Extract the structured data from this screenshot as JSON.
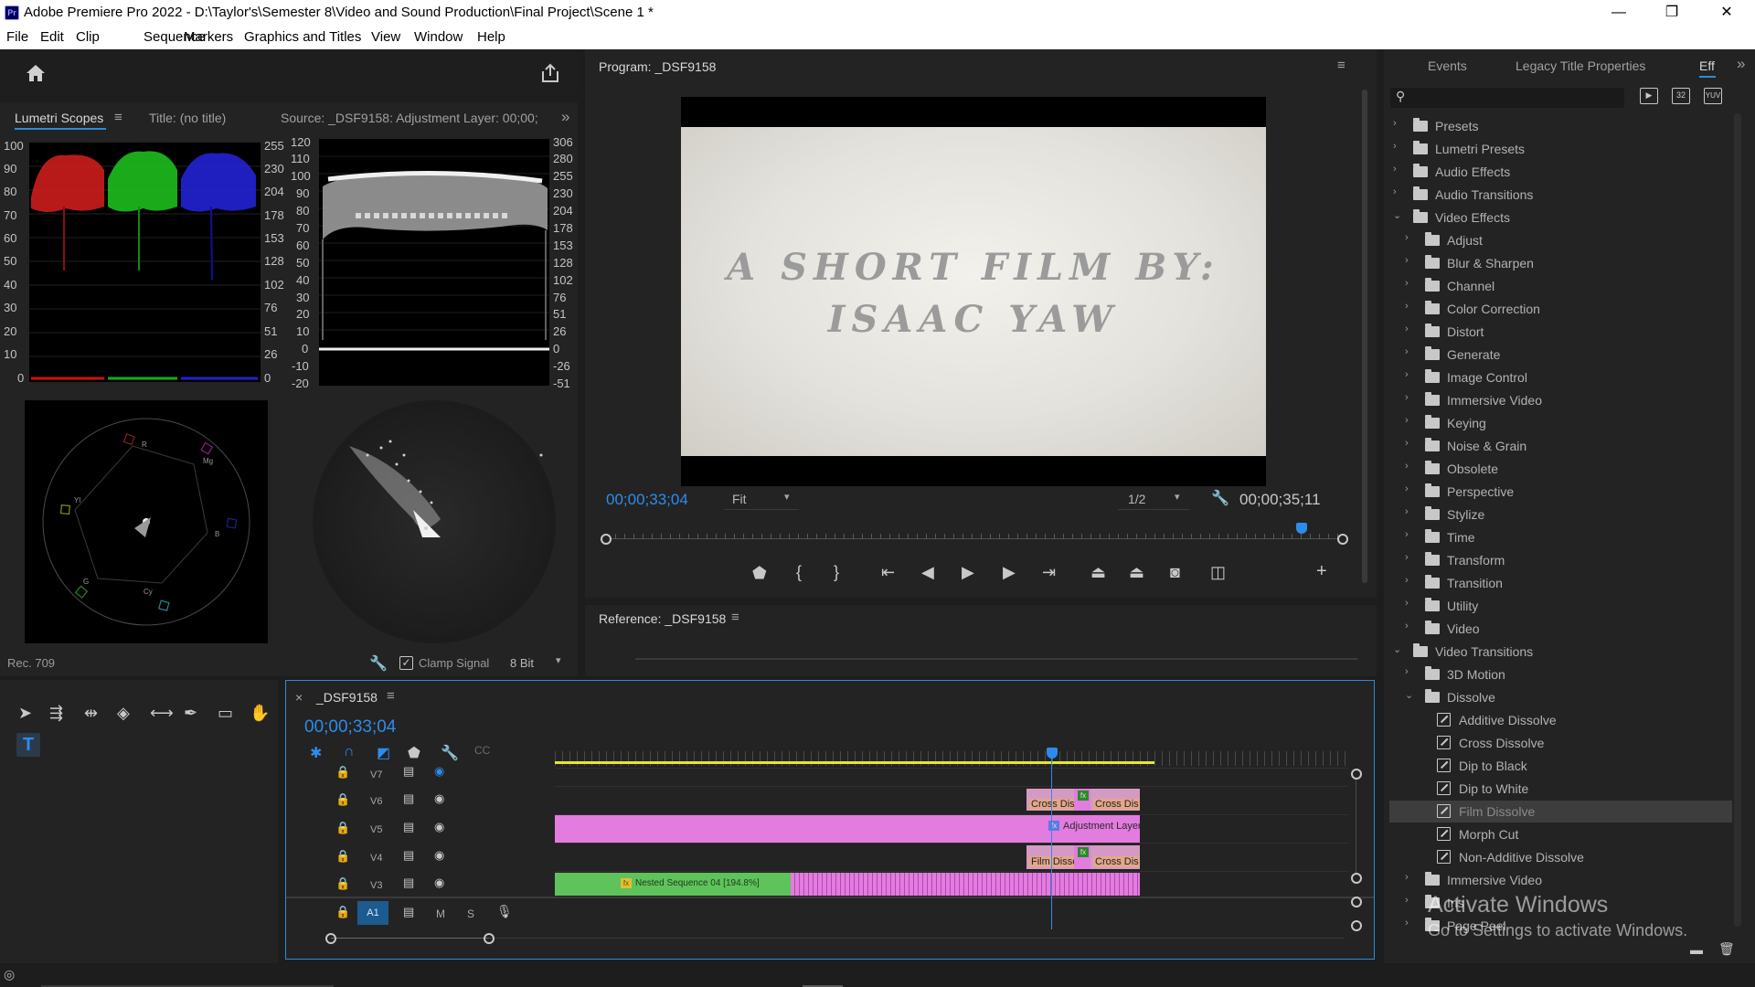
{
  "window": {
    "title": "Adobe Premiere Pro 2022 - D:\\Taylor's\\Semester 8\\Video and Sound Production\\Final Project\\Scene 1 *",
    "app_icon": "Pr",
    "minimize": "—",
    "maximize": "❐",
    "close": "✕"
  },
  "menu": [
    "File",
    "Edit",
    "Clip",
    "Sequence",
    "Markers",
    "Graphics and Titles",
    "View",
    "Window",
    "Help"
  ],
  "source_panel": {
    "tabs": {
      "lumetri": "Lumetri Scopes",
      "title": "Title: (no title)",
      "source": "Source: _DSF9158: Adjustment Layer: 00;00;"
    },
    "parade_scale": [
      "100",
      "90",
      "80",
      "70",
      "60",
      "50",
      "40",
      "30",
      "20",
      "10",
      "0"
    ],
    "parade_right_scale": [
      "255",
      "230",
      "204",
      "178",
      "153",
      "128",
      "102",
      "76",
      "51",
      "26",
      "0"
    ],
    "wave_left_scale": [
      "120",
      "110",
      "100",
      "90",
      "80",
      "70",
      "60",
      "50",
      "40",
      "30",
      "20",
      "10",
      "0",
      "-10",
      "-20"
    ],
    "wave_right_scale": [
      "306",
      "280",
      "255",
      "230",
      "204",
      "178",
      "153",
      "128",
      "102",
      "76",
      "51",
      "26",
      "0",
      "-26",
      "-51"
    ],
    "vectorscope_labels": {
      "r": "R",
      "mg": "Mg",
      "b": "B",
      "cy": "Cy",
      "g": "G",
      "yl": "Yl"
    },
    "footer": {
      "space": "Rec. 709",
      "clamp": "Clamp Signal",
      "bit": "8 Bit"
    }
  },
  "program": {
    "title": "Program: _DSF9158",
    "video_text_line1": "A SHORT FILM BY:",
    "video_text_line2": "ISAAC YAW",
    "timecode": "00;00;33;04",
    "fit": "Fit",
    "resolution": "1/2",
    "duration": "00;00;35;11",
    "playhead_fraction": 0.94
  },
  "reference": {
    "title": "Reference: _DSF9158"
  },
  "effects_panel": {
    "tabs": {
      "events": "Events",
      "legacy": "Legacy Title Properties",
      "eff": "Eff"
    },
    "search_placeholder": "",
    "items": [
      {
        "label": "Presets",
        "level": 0,
        "type": "special",
        "open": false
      },
      {
        "label": "Lumetri Presets",
        "level": 0,
        "type": "special",
        "open": false
      },
      {
        "label": "Audio Effects",
        "level": 0,
        "type": "folder",
        "open": false
      },
      {
        "label": "Audio Transitions",
        "level": 0,
        "type": "folder",
        "open": false
      },
      {
        "label": "Video Effects",
        "level": 0,
        "type": "folder",
        "open": true
      },
      {
        "label": "Adjust",
        "level": 1,
        "type": "folder",
        "open": false
      },
      {
        "label": "Blur & Sharpen",
        "level": 1,
        "type": "folder",
        "open": false
      },
      {
        "label": "Channel",
        "level": 1,
        "type": "folder",
        "open": false
      },
      {
        "label": "Color Correction",
        "level": 1,
        "type": "folder",
        "open": false
      },
      {
        "label": "Distort",
        "level": 1,
        "type": "folder",
        "open": false
      },
      {
        "label": "Generate",
        "level": 1,
        "type": "folder",
        "open": false
      },
      {
        "label": "Image Control",
        "level": 1,
        "type": "folder",
        "open": false
      },
      {
        "label": "Immersive Video",
        "level": 1,
        "type": "folder",
        "open": false
      },
      {
        "label": "Keying",
        "level": 1,
        "type": "folder",
        "open": false
      },
      {
        "label": "Noise & Grain",
        "level": 1,
        "type": "folder",
        "open": false
      },
      {
        "label": "Obsolete",
        "level": 1,
        "type": "folder",
        "open": false
      },
      {
        "label": "Perspective",
        "level": 1,
        "type": "folder",
        "open": false
      },
      {
        "label": "Stylize",
        "level": 1,
        "type": "folder",
        "open": false
      },
      {
        "label": "Time",
        "level": 1,
        "type": "folder",
        "open": false
      },
      {
        "label": "Transform",
        "level": 1,
        "type": "folder",
        "open": false
      },
      {
        "label": "Transition",
        "level": 1,
        "type": "folder",
        "open": false
      },
      {
        "label": "Utility",
        "level": 1,
        "type": "folder",
        "open": false
      },
      {
        "label": "Video",
        "level": 1,
        "type": "folder",
        "open": false
      },
      {
        "label": "Video Transitions",
        "level": 0,
        "type": "folder",
        "open": true
      },
      {
        "label": "3D Motion",
        "level": 1,
        "type": "folder",
        "open": false
      },
      {
        "label": "Dissolve",
        "level": 1,
        "type": "folder",
        "open": true
      },
      {
        "label": "Additive Dissolve",
        "level": 2,
        "type": "effect"
      },
      {
        "label": "Cross Dissolve",
        "level": 2,
        "type": "effect"
      },
      {
        "label": "Dip to Black",
        "level": 2,
        "type": "effect"
      },
      {
        "label": "Dip to White",
        "level": 2,
        "type": "effect"
      },
      {
        "label": "Film Dissolve",
        "level": 2,
        "type": "effect",
        "selected": true
      },
      {
        "label": "Morph Cut",
        "level": 2,
        "type": "effect"
      },
      {
        "label": "Non-Additive Dissolve",
        "level": 2,
        "type": "effect"
      },
      {
        "label": "Immersive Video",
        "level": 1,
        "type": "folder",
        "open": false
      },
      {
        "label": "Iris",
        "level": 1,
        "type": "folder",
        "open": false
      },
      {
        "label": "Page Peel",
        "level": 1,
        "type": "folder",
        "open": false
      }
    ],
    "watermark_line1": "Activate Windows",
    "watermark_line2": "Go to Settings to activate Windows."
  },
  "timeline": {
    "sequence_name": "_DSF9158",
    "timecode": "00;00;33;04",
    "tracks": [
      "V7",
      "V6",
      "V5",
      "V4",
      "V3"
    ],
    "audio_track": "A1",
    "audio_buttons": {
      "mute": "M",
      "solo": "S"
    },
    "clips": {
      "v6_left": "Cross Diss",
      "v6_right": "Cross Dis",
      "v5": "Adjustment Layer",
      "v4_left": "Film Disso",
      "v4_right": "Cross Dis",
      "v3": "Nested Sequence 04 [194.8%]"
    }
  }
}
